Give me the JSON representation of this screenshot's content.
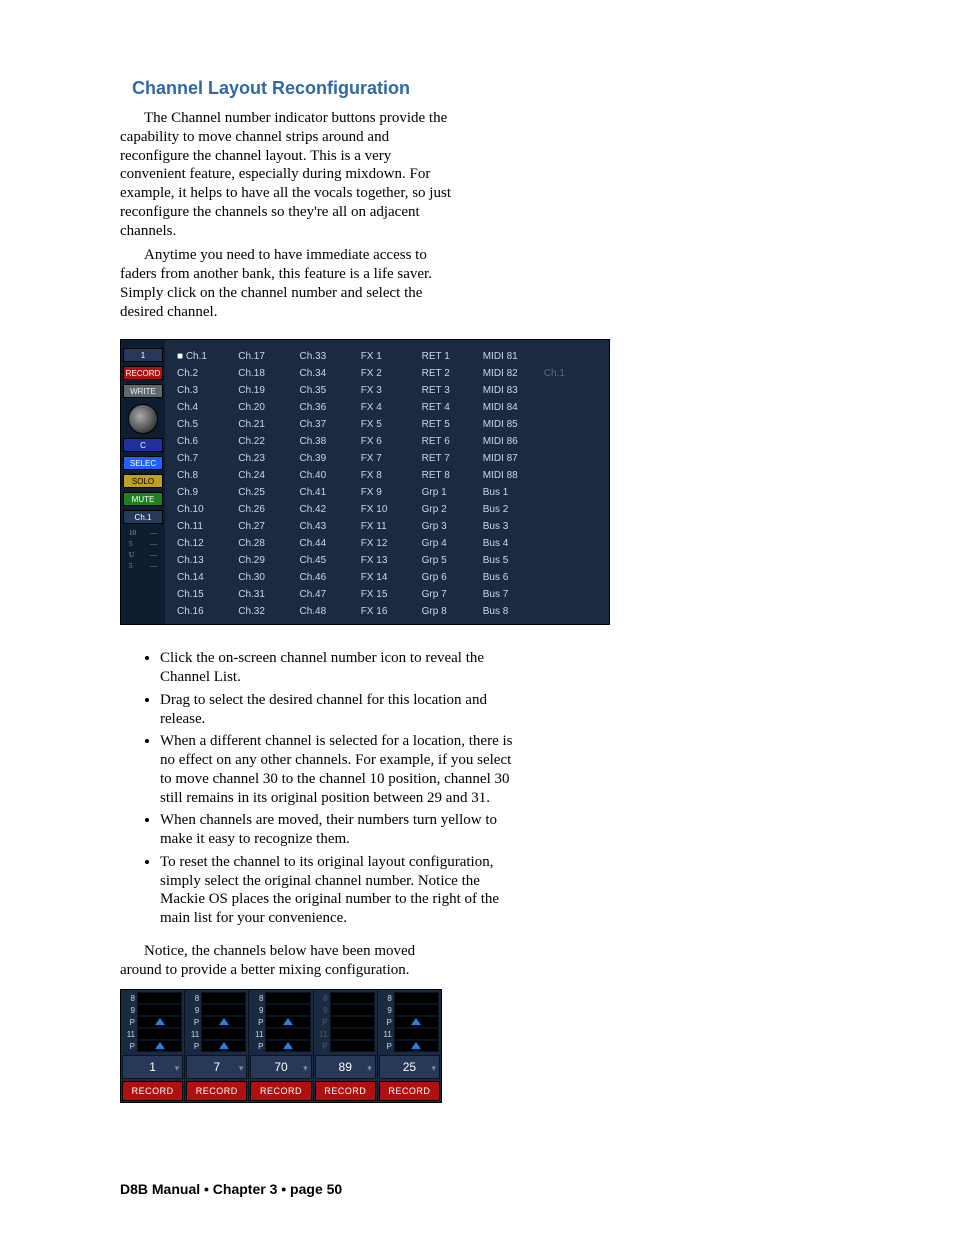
{
  "title": "Channel Layout Reconfiguration",
  "para1": "The Channel number indicator buttons provide the capability to move channel strips around and reconfigure the channel layout. This is a very convenient feature, especially during mixdown. For example, it helps to have all the vocals together, so just reconfigure the channels so they're all on adjacent channels.",
  "para2": "Anytime you need to have immediate access to faders from another bank, this feature is a life saver. Simply click on the channel number and select the desired channel.",
  "sidebar": {
    "chnum": "1",
    "record": "RECORD",
    "write": "WRITE",
    "c": "C",
    "selec": "SELEC",
    "solo": "SOLO",
    "mute": "MUTE",
    "ch1": "Ch.1",
    "scale": [
      "10",
      "5",
      "U",
      "5"
    ]
  },
  "channel_columns": [
    [
      "Ch.1",
      "Ch.2",
      "Ch.3",
      "Ch.4",
      "Ch.5",
      "Ch.6",
      "Ch.7",
      "Ch.8",
      "Ch.9",
      "Ch.10",
      "Ch.11",
      "Ch.12",
      "Ch.13",
      "Ch.14",
      "Ch.15",
      "Ch.16"
    ],
    [
      "Ch.17",
      "Ch.18",
      "Ch.19",
      "Ch.20",
      "Ch.21",
      "Ch.22",
      "Ch.23",
      "Ch.24",
      "Ch.25",
      "Ch.26",
      "Ch.27",
      "Ch.28",
      "Ch.29",
      "Ch.30",
      "Ch.31",
      "Ch.32"
    ],
    [
      "Ch.33",
      "Ch.34",
      "Ch.35",
      "Ch.36",
      "Ch.37",
      "Ch.38",
      "Ch.39",
      "Ch.40",
      "Ch.41",
      "Ch.42",
      "Ch.43",
      "Ch.44",
      "Ch.45",
      "Ch.46",
      "Ch.47",
      "Ch.48"
    ],
    [
      "FX 1",
      "FX 2",
      "FX 3",
      "FX 4",
      "FX 5",
      "FX 6",
      "FX 7",
      "FX 8",
      "FX 9",
      "FX 10",
      "FX 11",
      "FX 12",
      "FX 13",
      "FX 14",
      "FX 15",
      "FX 16"
    ],
    [
      "RET 1",
      "RET 2",
      "RET 3",
      "RET 4",
      "RET 5",
      "RET 6",
      "RET 7",
      "RET 8",
      "Grp 1",
      "Grp 2",
      "Grp 3",
      "Grp 4",
      "Grp 5",
      "Grp 6",
      "Grp 7",
      "Grp 8"
    ],
    [
      "MIDI 81",
      "MIDI 82",
      "MIDI 83",
      "MIDI 84",
      "MIDI 85",
      "MIDI 86",
      "MIDI 87",
      "MIDI 88",
      "Bus 1",
      "Bus 2",
      "Bus 3",
      "Bus 4",
      "Bus 5",
      "Bus 6",
      "Bus 7",
      "Bus 8"
    ],
    [
      "",
      "Ch.1",
      "",
      "",
      "",
      "",
      "",
      "",
      "",
      "",
      "",
      "",
      "",
      "",
      "",
      ""
    ]
  ],
  "selected_cell": {
    "col": 0,
    "row": 0
  },
  "bullets": [
    "Click the on-screen channel number icon to reveal the Channel List.",
    "Drag to select the desired channel for this location and release.",
    "When a different channel is selected for a location, there is no effect on any other channels. For example, if you select to move channel 30 to the channel 10 position, channel 30 still remains in its original position between 29 and 31.",
    "When channels are moved, their numbers turn yellow to make it easy to recognize them.",
    "To reset the channel to its original layout configuration, simply select the original channel number. Notice the Mackie OS places the original number to the right of the main list for your convenience."
  ],
  "para3": "Notice, the channels below have been moved around to provide a better mixing configuration.",
  "strips": [
    {
      "num": "1",
      "rows": [
        {
          "l": "8",
          "on": false
        },
        {
          "l": "9",
          "on": false
        },
        {
          "l": "P",
          "on": true
        },
        {
          "l": "11",
          "on": false
        },
        {
          "l": "P",
          "on": true
        }
      ],
      "dim": false
    },
    {
      "num": "7",
      "rows": [
        {
          "l": "8",
          "on": false
        },
        {
          "l": "9",
          "on": false
        },
        {
          "l": "P",
          "on": true
        },
        {
          "l": "11",
          "on": false
        },
        {
          "l": "P",
          "on": true
        }
      ],
      "dim": false
    },
    {
      "num": "70",
      "rows": [
        {
          "l": "8",
          "on": false
        },
        {
          "l": "9",
          "on": false
        },
        {
          "l": "P",
          "on": true
        },
        {
          "l": "11",
          "on": false
        },
        {
          "l": "P",
          "on": true
        }
      ],
      "dim": false
    },
    {
      "num": "89",
      "rows": [
        {
          "l": "8",
          "on": false
        },
        {
          "l": "9",
          "on": false
        },
        {
          "l": "P",
          "on": false
        },
        {
          "l": "11",
          "on": false
        },
        {
          "l": "P",
          "on": false
        }
      ],
      "dim": true
    },
    {
      "num": "25",
      "rows": [
        {
          "l": "8",
          "on": false
        },
        {
          "l": "9",
          "on": false
        },
        {
          "l": "P",
          "on": true
        },
        {
          "l": "11",
          "on": false
        },
        {
          "l": "P",
          "on": true
        }
      ],
      "dim": false
    }
  ],
  "strip_record_label": "RECORD",
  "footer": "D8B Manual • Chapter 3 • page  50"
}
